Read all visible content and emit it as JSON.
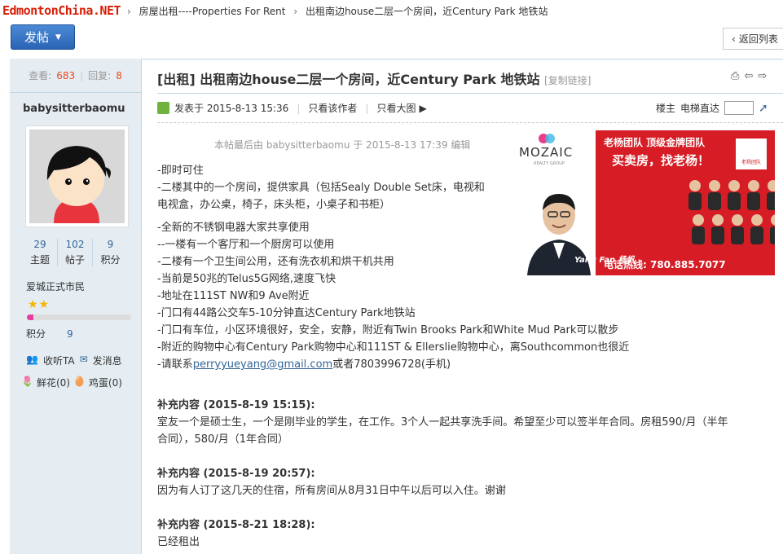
{
  "site": {
    "logo": "EdmontonChina.NET"
  },
  "breadcrumb": {
    "hidden_part": "",
    "forum": "房屋出租----Properties For Rent",
    "thread": "出租南边house二层一个房间，近Century Park 地铁站"
  },
  "toolbar": {
    "post_label": "发帖",
    "back_label": "返回列表"
  },
  "thread_stats": {
    "views_label": "查看:",
    "views": "683",
    "replies_label": "回复:",
    "replies": "8"
  },
  "author": {
    "name": "babysitterbaomu",
    "stats": [
      {
        "value": "29",
        "label": "主题"
      },
      {
        "value": "102",
        "label": "帖子"
      },
      {
        "value": "9",
        "label": "积分"
      }
    ],
    "rank": "爱城正式市民",
    "stars": "★★",
    "level_progress": 0.06,
    "credit_label": "积分",
    "credit_value": "9",
    "follow_label": "收听TA",
    "message_label": "发消息",
    "flowers_label": "鲜花(0)",
    "eggs_label": "鸡蛋(0)"
  },
  "post": {
    "title": "[出租] 出租南边house二层一个房间，近Century Park 地铁站",
    "copy_link": "[复制链接]",
    "posted_at": "发表于 2015-8-13 15:36",
    "only_author": "只看该作者",
    "big_image": "只看大图",
    "floor_label": "楼主",
    "elevator_label": "电梯直达",
    "edit_note": "本帖最后由 babysitterbaomu 于 2015-8-13 17:39 编辑",
    "lines_group1": [
      "-即时可住",
      "-二楼其中的一个房间，提供家具（包括Sealy Double Set床，电视和",
      "电视盒，办公桌，椅子，床头柜，小桌子和书柜）"
    ],
    "lines_group2": [
      "-全新的不锈钢电器大家共享使用",
      "--一楼有一个客厅和一个厨房可以使用",
      "-二楼有一个卫生间公用，还有洗衣机和烘干机共用",
      "-当前是50兆的Telus5G网络,速度飞快",
      "-地址在111ST NW和9 Ave附近",
      "-门口有44路公交车5-10分钟直达Century Park地铁站",
      "-门口有车位，小区环境很好，安全，安静，附近有Twin Brooks Park和White Mud Park可以散步",
      "-附近的购物中心有Century Park购物中心和111ST & Ellerslie购物中心，离Southcommon也很近"
    ],
    "contact_prefix": "-请联系",
    "contact_email": "perryyueyang@gmail.com",
    "contact_suffix": "或者7803996728(手机)",
    "supplements": [
      {
        "header": "补充内容 (2015-8-19 15:15):",
        "text1": "室友一个是硕士生，一个是刚毕业的学生，在工作。3个人一起共享洗手间。希望至少可以签半年合同。房租590/月（半年",
        "text2": "合同），580/月（1年合同）"
      },
      {
        "header": "补充内容 (2015-8-19 20:57):",
        "text1": "因为有人订了这几天的住宿，所有房间从8月31日中午以后可以入住。谢谢"
      },
      {
        "header": "补充内容 (2015-8-21 18:28):",
        "text1": "已经租出"
      }
    ]
  },
  "ad": {
    "brand": "MOZAIC",
    "brand_sub": "REALTY GROUP",
    "line1": "老杨团队 顶级金牌团队",
    "line2": "买卖房，找老杨！",
    "team_badge": "老杨团队",
    "signature": "Yang Fan 杨帆",
    "phone": "电话热线: 780.885.7077"
  },
  "colors": {
    "accent": "#336699",
    "post_button": "#2a64b4",
    "ad_red": "#d61c24",
    "number_red": "#e94a1f"
  }
}
